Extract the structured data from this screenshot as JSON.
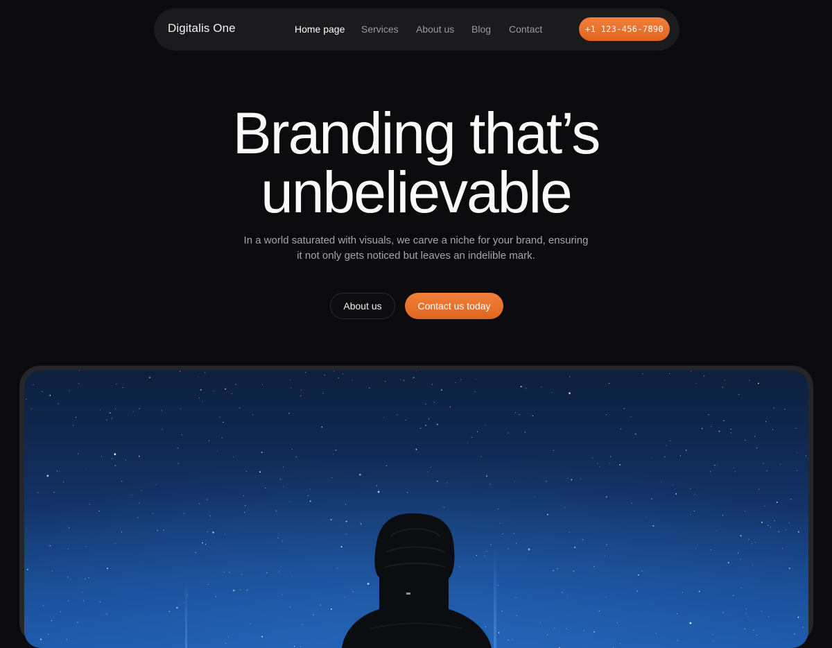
{
  "header": {
    "brand": "Digitalis One",
    "nav": [
      {
        "label": "Home page",
        "active": true
      },
      {
        "label": "Services",
        "active": false
      },
      {
        "label": "About us",
        "active": false
      },
      {
        "label": "Blog",
        "active": false
      },
      {
        "label": "Contact",
        "active": false
      }
    ],
    "phone": "+1 123-456-7890"
  },
  "hero": {
    "title_line1": "Branding that’s",
    "title_line2": "unbelievable",
    "subtitle_line1": "In a world saturated with visuals, we carve a niche for your brand, ensuring",
    "subtitle_line2": "it not only gets noticed but leaves an indelible mark.",
    "secondary_cta": "About us",
    "primary_cta": "Contact us today"
  },
  "colors": {
    "background": "#0b0b0d",
    "accent": "#ea7430",
    "nav_bg": "#1b1b1e"
  },
  "image": {
    "subject": "night-sky-hooded-figure"
  }
}
